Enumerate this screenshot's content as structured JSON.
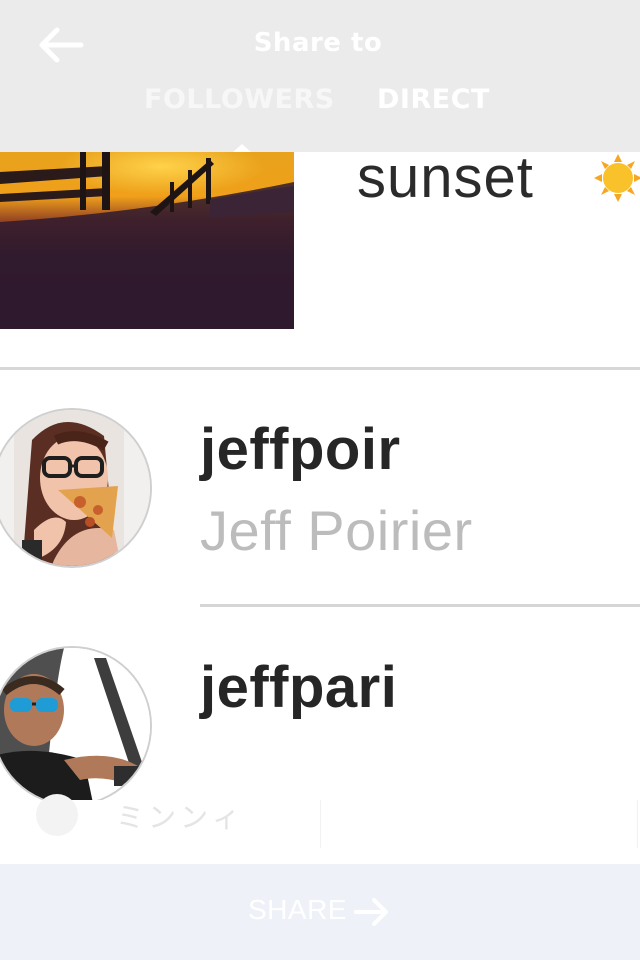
{
  "header": {
    "title": "Share to",
    "back_icon": "arrow-left-icon",
    "tabs": [
      {
        "label": "FOLLOWERS",
        "selected": true
      },
      {
        "label": "DIRECT",
        "selected": false
      }
    ]
  },
  "preview": {
    "caption": "sunset",
    "caption_emoji_icon": "sun-icon",
    "thumbnail": "sunset-boardwalk-photo"
  },
  "users": [
    {
      "username": "jeffpoir",
      "full_name": "Jeff Poirier",
      "avatar": "woman-eating-pizza-photo"
    },
    {
      "username": "jeffpari",
      "full_name": "",
      "avatar": "man-in-car-sunglasses-photo"
    }
  ],
  "options_strip": {
    "label": "ミンンィ"
  },
  "share_bar": {
    "label": "SHARE",
    "icon": "arrow-right-icon"
  },
  "colors": {
    "header_bg": "#ebebeb",
    "share_bar_bg": "#eef2f8",
    "username_text": "#262626",
    "fullname_text": "#bcbcbc",
    "divider": "#d5d5d5"
  }
}
